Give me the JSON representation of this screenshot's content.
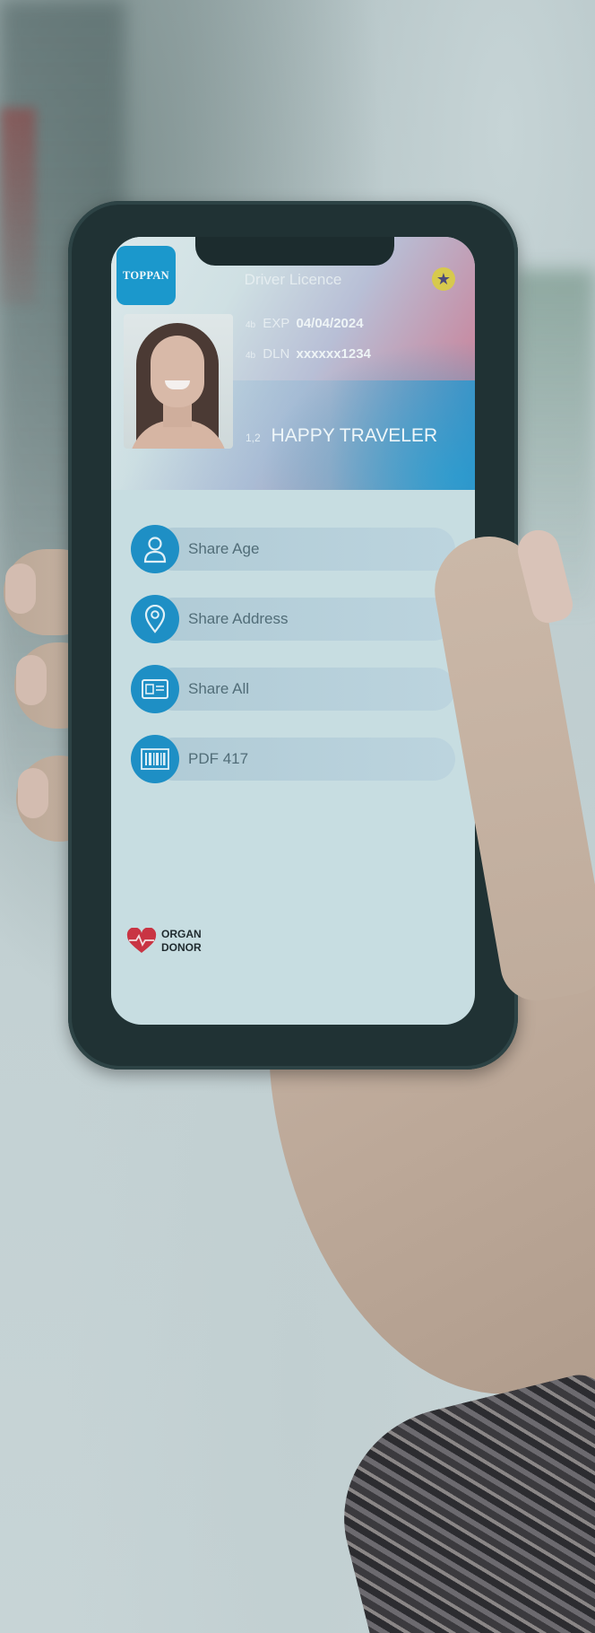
{
  "card": {
    "issuer_logo": "TOPPAN",
    "title": "Driver Licence",
    "badge_icon": "star-icon",
    "fields": [
      {
        "code": "4b",
        "label": "EXP",
        "value": "04/04/2024"
      },
      {
        "code": "4b",
        "label": "DLN",
        "value": "xxxxxx1234"
      }
    ],
    "name_code": "1,2",
    "holder_name": "HAPPY TRAVELER"
  },
  "actions": [
    {
      "label": "Share Age",
      "icon": "person-icon"
    },
    {
      "label": "Share Address",
      "icon": "location-pin-icon"
    },
    {
      "label": "Share All",
      "icon": "id-card-icon"
    },
    {
      "label": "PDF 417",
      "icon": "barcode-icon"
    }
  ],
  "organ_donor": {
    "line1": "ORGAN",
    "line2": "DONOR",
    "icon": "heart-pulse-icon"
  },
  "colors": {
    "accent": "#1e8fc5",
    "pill": "#b6cfda",
    "screen_bg": "#c7dde1"
  }
}
